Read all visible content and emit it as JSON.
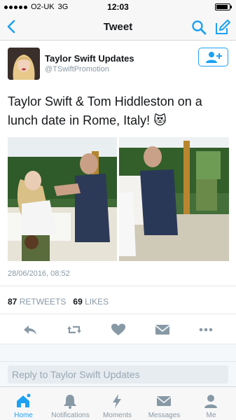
{
  "status_bar": {
    "carrier": "O2-UK",
    "network": "3G",
    "time": "12:03",
    "battery_level": 0.9
  },
  "nav": {
    "title": "Tweet"
  },
  "tweet": {
    "author_name": "Taylor Swift Updates",
    "author_handle": "@TSwiftPromotion",
    "text": "Taylor Swift & Tom Hiddleston on a lunch date in Rome, Italy! 😻",
    "timestamp": "28/06/2016, 08:52",
    "retweets_count": "87",
    "retweets_label": "RETWEETS",
    "likes_count": "69",
    "likes_label": "LIKES"
  },
  "reply": {
    "placeholder": "Reply to Taylor Swift Updates"
  },
  "tabs": [
    {
      "label": "Home",
      "icon": "home-icon",
      "active": true
    },
    {
      "label": "Notifications",
      "icon": "bell-icon"
    },
    {
      "label": "Moments",
      "icon": "lightning-icon"
    },
    {
      "label": "Messages",
      "icon": "envelope-icon"
    },
    {
      "label": "Me",
      "icon": "person-icon"
    }
  ],
  "colors": {
    "accent": "#1da1f2",
    "muted": "#8899a6",
    "text": "#14171a"
  }
}
